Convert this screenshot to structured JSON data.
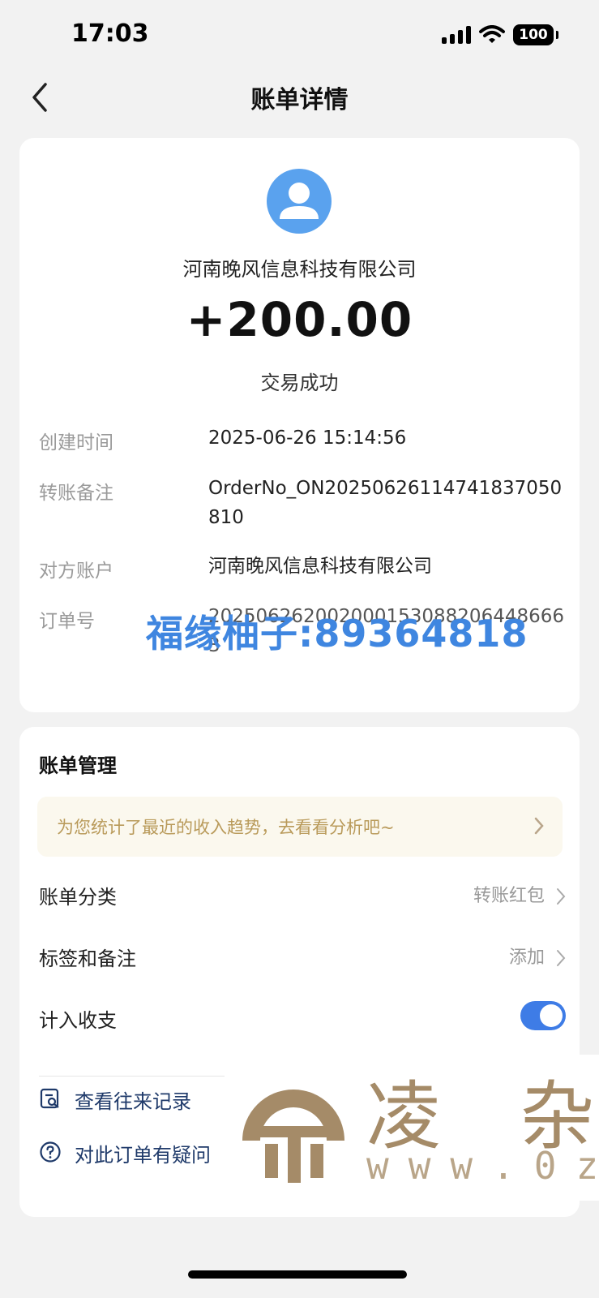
{
  "status_bar": {
    "time": "17:03",
    "battery": "100"
  },
  "nav": {
    "title": "账单详情"
  },
  "transaction": {
    "merchant": "河南晚风信息科技有限公司",
    "amount": "+200.00",
    "status": "交易成功"
  },
  "details": [
    {
      "label": "创建时间",
      "value": "2025-06-26 15:14:56"
    },
    {
      "label": "转账备注",
      "value": "OrderNo_ON20250626114741837050810"
    },
    {
      "label": "对方账户",
      "value": "河南晚风信息科技有限公司"
    },
    {
      "label": "订单号",
      "value": "2025062620020001530882064486663"
    }
  ],
  "watermark": {
    "text": "福缘柚子:89364818",
    "logo_text": "凌 杂",
    "logo_url": "www.0z"
  },
  "manage": {
    "title": "账单管理",
    "promo": "为您统计了最近的收入趋势，去看看分析吧~",
    "rows": [
      {
        "label": "账单分类",
        "value": "转账红包"
      },
      {
        "label": "标签和备注",
        "value": "添加"
      },
      {
        "label": "计入收支",
        "value": ""
      }
    ],
    "links": [
      {
        "label": "查看往来记录"
      },
      {
        "label": "对此订单有疑问"
      }
    ]
  },
  "colors": {
    "accent": "#3e7ce6",
    "avatar": "#5aa2ee",
    "promo_text": "#b99a5a",
    "watermark_blue": "#3f86e0"
  }
}
